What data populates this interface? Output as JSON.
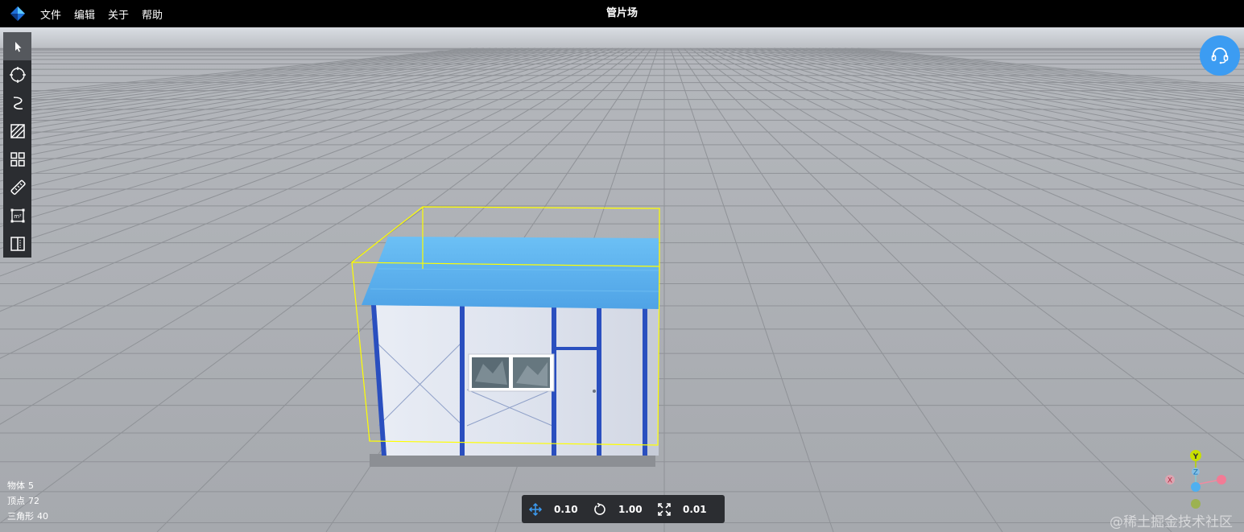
{
  "app": {
    "title": "管片场",
    "logo_icon": "logo-icon"
  },
  "menu": [
    {
      "label": "文件"
    },
    {
      "label": "编辑"
    },
    {
      "label": "关于"
    },
    {
      "label": "帮助"
    }
  ],
  "toolbar": [
    {
      "icon": "cursor-icon",
      "active": true
    },
    {
      "icon": "circle-select-icon",
      "active": false
    },
    {
      "icon": "curve-icon",
      "active": false
    },
    {
      "icon": "hatch-area-icon",
      "active": false
    },
    {
      "icon": "grid-icon",
      "active": false
    },
    {
      "icon": "ruler-icon",
      "active": false
    },
    {
      "icon": "area-measure-icon",
      "active": false
    },
    {
      "icon": "split-view-icon",
      "active": false
    }
  ],
  "stats": {
    "objects_label": "物体",
    "objects_value": "5",
    "vertices_label": "顶点",
    "vertices_value": "72",
    "triangles_label": "三角形",
    "triangles_value": "40"
  },
  "transform": {
    "move_value": "0.10",
    "rotate_value": "1.00",
    "scale_value": "0.01"
  },
  "gizmo": {
    "x_label": "X",
    "y_label": "Y",
    "z_label": "Z"
  },
  "watermark": "@稀土掘金技术社区",
  "colors": {
    "accent": "#3c9cf2",
    "selection": "#ffff00",
    "roof": "#5aaeea",
    "frame": "#2a4fbf"
  }
}
